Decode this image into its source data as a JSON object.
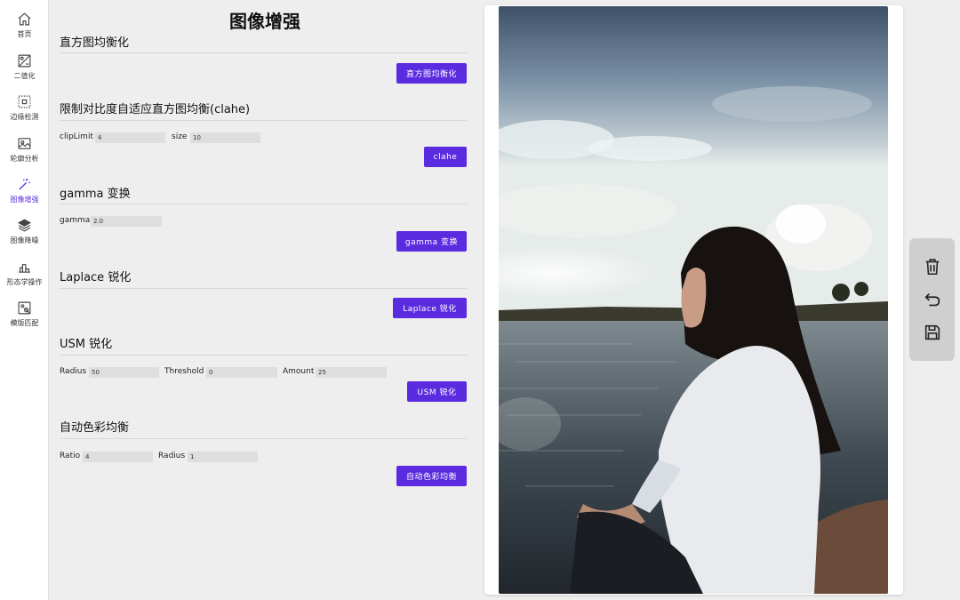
{
  "sidebar": {
    "items": [
      {
        "label": "首页",
        "icon": "home-icon"
      },
      {
        "label": "二值化",
        "icon": "binarize-icon"
      },
      {
        "label": "边缘检测",
        "icon": "edge-detect-icon"
      },
      {
        "label": "轮廓分析",
        "icon": "contour-icon"
      },
      {
        "label": "图像增强",
        "icon": "magic-wand-icon",
        "active": true
      },
      {
        "label": "图像降噪",
        "icon": "layers-icon"
      },
      {
        "label": "形态学操作",
        "icon": "morphology-icon"
      },
      {
        "label": "模版匹配",
        "icon": "template-match-icon"
      }
    ]
  },
  "main": {
    "title": "图像增强",
    "histeq": {
      "title": "直方图均衡化",
      "button": "直方图均衡化"
    },
    "clahe": {
      "title": "限制对比度自适应直方图均衡(clahe)",
      "cliplimit_label": "clipLimit",
      "cliplimit_value": "4",
      "size_label": "size",
      "size_value": "10",
      "button": "clahe"
    },
    "gamma": {
      "title": "gamma 变换",
      "gamma_label": "gamma",
      "gamma_value": "2.0",
      "button": "gamma 变换"
    },
    "laplace": {
      "title": "Laplace 锐化",
      "button": "Laplace 锐化"
    },
    "usm": {
      "title": "USM 锐化",
      "radius_label": "Radius",
      "radius_value": "50",
      "threshold_label": "Threshold",
      "threshold_value": "0",
      "amount_label": "Amount",
      "amount_value": "25",
      "button": "USM 锐化"
    },
    "acb": {
      "title": "自动色彩均衡",
      "ratio_label": "Ratio",
      "ratio_value": "4",
      "radius_label": "Radius",
      "radius_value": "1",
      "button": "自动色彩均衡"
    }
  },
  "toolbar": {
    "delete_icon": "trash-icon",
    "undo_icon": "undo-icon",
    "save_icon": "save-icon"
  },
  "colors": {
    "accent": "#5b2be0",
    "background": "#eeeeee",
    "toolbar": "#cfcfcf"
  }
}
